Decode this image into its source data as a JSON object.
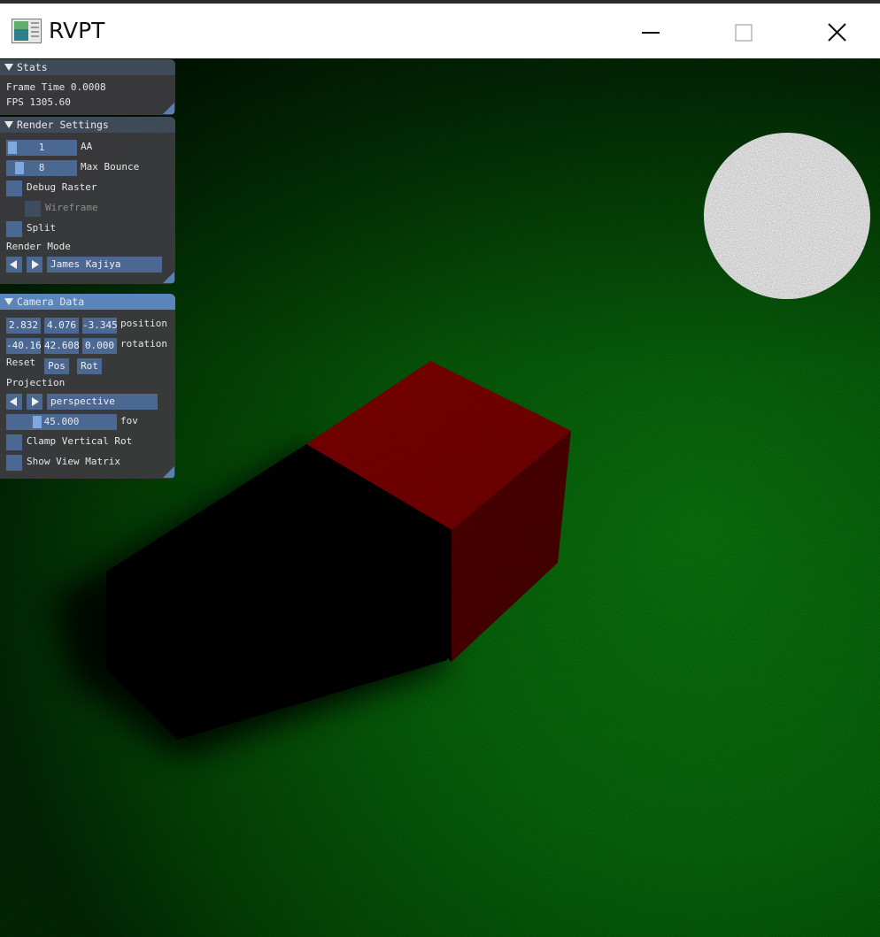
{
  "window": {
    "title": "RVPT"
  },
  "stats": {
    "header": "Stats",
    "frame_time": "Frame Time 0.0008",
    "fps": "FPS 1305.60"
  },
  "render_settings": {
    "header": "Render Settings",
    "aa_value": "1",
    "aa_label": "AA",
    "aa_level": 0.0,
    "max_bounce_value": "8",
    "max_bounce_label": "Max Bounce",
    "max_bounce_level": 0.12,
    "debug_raster_label": "Debug Raster",
    "debug_raster_checked": false,
    "wireframe_label": "Wireframe",
    "wireframe_checked": false,
    "split_label": "Split",
    "split_checked": false,
    "render_mode_label": "Render Mode",
    "render_mode_value": "James Kajiya"
  },
  "camera_data": {
    "header": "Camera Data",
    "position": [
      "2.832",
      "4.076",
      "-3.345"
    ],
    "position_label": "position",
    "rotation": [
      "-40.16",
      "42.608",
      "0.000"
    ],
    "rotation_label": "rotation",
    "reset_label": "Reset",
    "pos_button": "Pos",
    "rot_button": "Rot",
    "projection_label": "Projection",
    "projection_value": "perspective",
    "fov_value": "45.000",
    "fov_label": "fov",
    "fov_level": 0.25,
    "clamp_vertical_rot_label": "Clamp Vertical Rot",
    "clamp_vertical_rot_checked": false,
    "show_view_matrix_label": "Show View Matrix",
    "show_view_matrix_checked": false
  },
  "icons": {
    "app": "app-icon",
    "minimize": "minimize-icon",
    "maximize": "maximize-icon",
    "close": "close-icon",
    "collapse": "collapse-triangle-icon",
    "resize": "resize-grip-icon",
    "arrow_left": "arrow-left-icon",
    "arrow_right": "arrow-right-icon"
  },
  "colors": {
    "floor": "#0d6b0f",
    "cube_top": "#8a0000",
    "cube_side": "#5c0000",
    "light": "#ffffff",
    "widget": "#4a6891",
    "header_active": "#5a86bb"
  }
}
